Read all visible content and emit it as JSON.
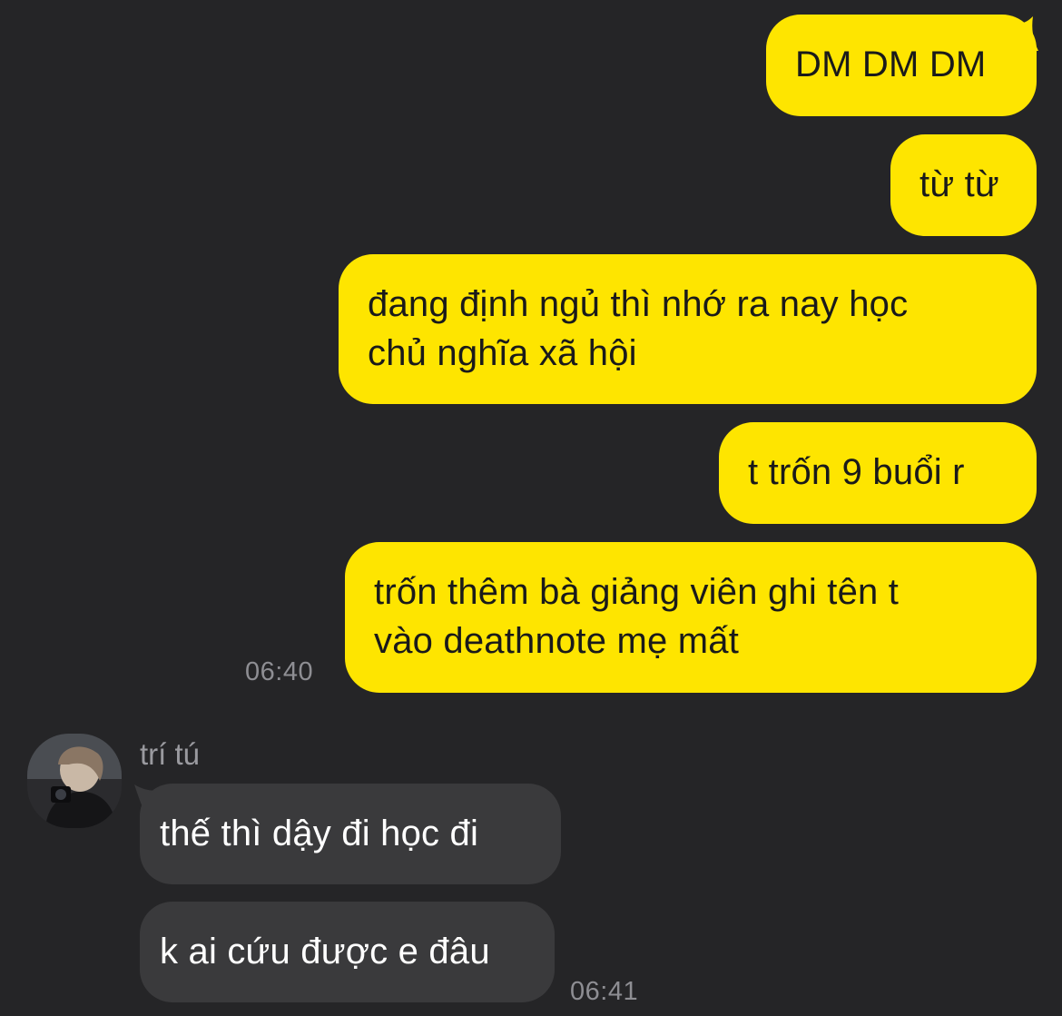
{
  "messages_out": [
    {
      "text": "DM DM DM"
    },
    {
      "text": "từ từ"
    },
    {
      "text": "đang định ngủ thì nhớ ra nay học\nchủ nghĩa xã hội"
    },
    {
      "text": "t trốn 9 buổi r"
    },
    {
      "text": "trốn thêm bà giảng viên ghi tên t\nvào deathnote mẹ mất"
    }
  ],
  "time_out": "06:40",
  "contact": {
    "name": "trí tú",
    "avatar_icon": "user-avatar-photo"
  },
  "messages_in": [
    {
      "text": "thế thì dậy đi học đi"
    },
    {
      "text": "k ai cứu được e đâu"
    }
  ],
  "time_in": "06:41",
  "colors": {
    "background": "#252527",
    "outgoing_bubble": "#fee500",
    "incoming_bubble": "#3a3a3c",
    "timestamp": "#8e8e93"
  }
}
